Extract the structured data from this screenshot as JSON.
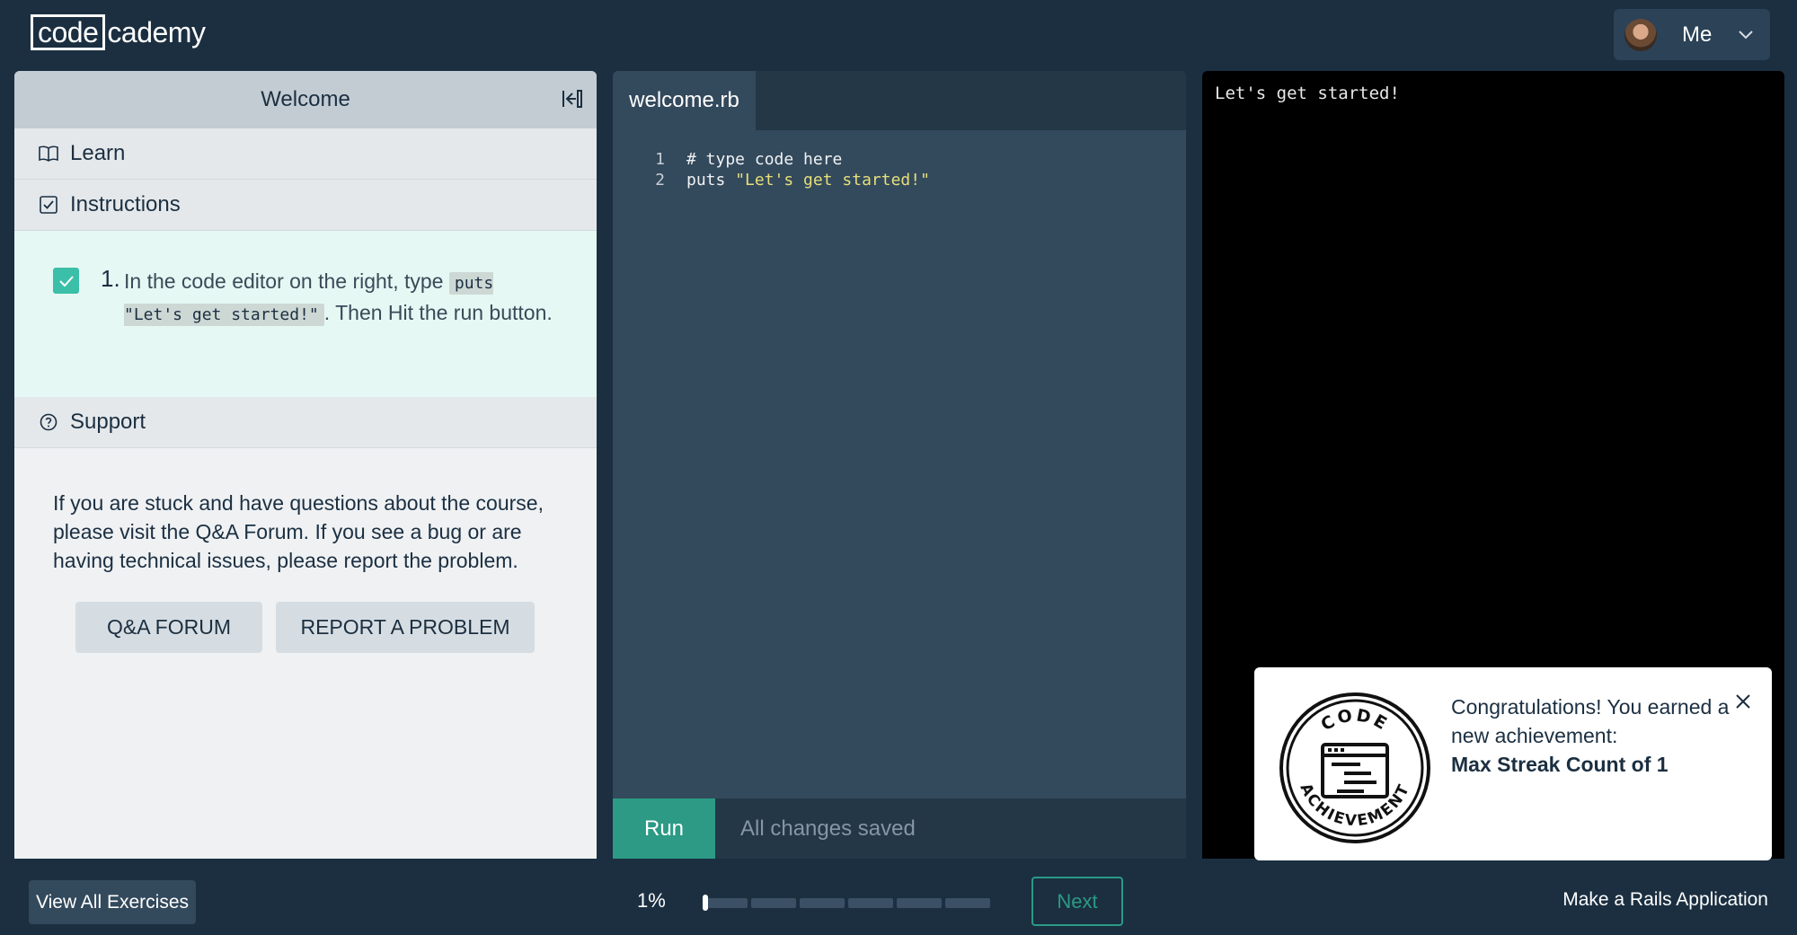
{
  "header": {
    "logo_boxed": "code",
    "logo_rest": "cademy",
    "user_name": "Me"
  },
  "left_panel": {
    "title": "Welcome",
    "learn_label": "Learn",
    "instructions_label": "Instructions",
    "instruction": {
      "number": "1.",
      "text_before": "In the code editor on the right, type ",
      "code": "puts \"Let's get started!\"",
      "text_after": ". Then Hit the run button.",
      "completed": true
    },
    "support_label": "Support",
    "support_text": "If you are stuck and have questions about the course, please visit the Q&A Forum. If you see a bug or are having technical issues, please report the problem.",
    "qa_button": "Q&A FORUM",
    "report_button": "REPORT A PROBLEM"
  },
  "editor": {
    "tab_name": "welcome.rb",
    "lines": [
      {
        "num": "1",
        "code": "# type code here",
        "string": ""
      },
      {
        "num": "2",
        "code": "puts ",
        "string": "\"Let's get started!\""
      }
    ],
    "run_label": "Run",
    "status": "All changes saved"
  },
  "terminal": {
    "output": "Let's get started!"
  },
  "toast": {
    "line1": "Congratulations! You earned a new achievement:",
    "achievement": "Max Streak Count of 1",
    "badge_top": "CODE",
    "badge_bottom": "ACHIEVEMENT"
  },
  "footer": {
    "view_all": "View All Exercises",
    "progress_label": "1%",
    "progress_fraction": 0.01,
    "next_label": "Next",
    "course_name": "Make a Rails Application"
  },
  "colors": {
    "background": "#1b2f41",
    "accent": "#2c9a85",
    "check": "#3bbfa8",
    "editor": "#33495c",
    "string": "#e6df7a"
  }
}
